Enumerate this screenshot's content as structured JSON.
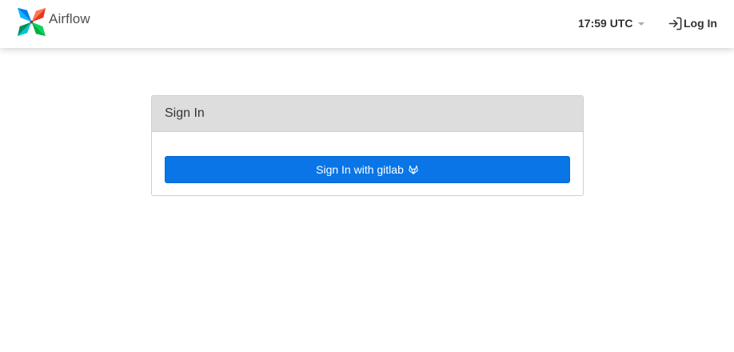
{
  "navbar": {
    "brand_name": "Airflow",
    "clock": "17:59 UTC",
    "login_label": "Log In",
    "icons": [
      "airflow-pinwheel-logo",
      "chevron-down-icon",
      "login-icon"
    ]
  },
  "panel": {
    "title": "Sign In",
    "button_label": "Sign In with gitlab",
    "button_icon": "gitlab-icon",
    "button_color": "#0975e6"
  }
}
